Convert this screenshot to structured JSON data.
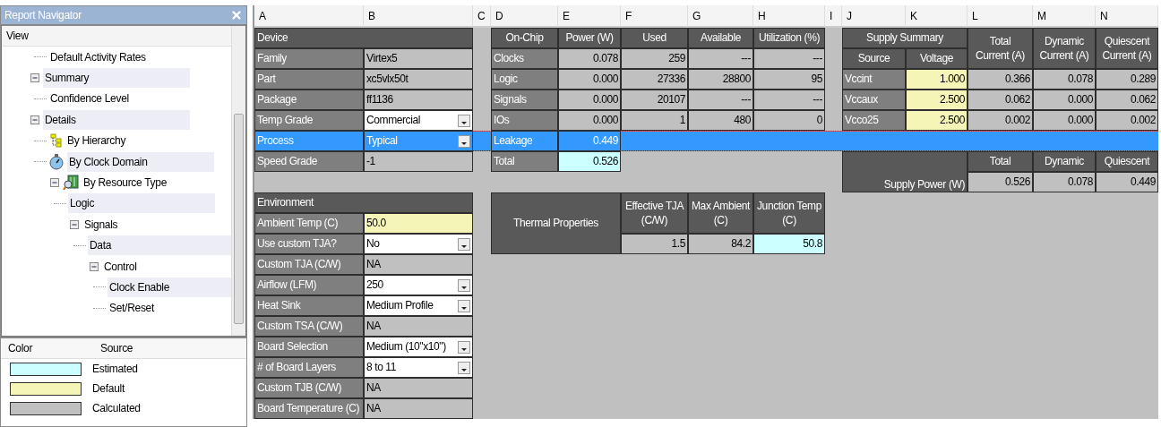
{
  "navigator": {
    "title": "Report Navigator",
    "view_header": "View",
    "tree": [
      {
        "children": [
          {
            "label": "Default Activity Rates",
            "shaded": false
          }
        ]
      },
      {
        "label": "Summary",
        "shaded": true,
        "expanded": true,
        "children": [
          {
            "label": "Confidence Level",
            "shaded": false
          }
        ]
      },
      {
        "label": "Details",
        "shaded": true,
        "expanded": true,
        "children": [
          {
            "label": "By Hierarchy",
            "kind": "hierarchy",
            "shaded": false
          },
          {
            "label": "By Clock Domain",
            "kind": "clock",
            "shaded": true
          },
          {
            "label": "By Resource Type",
            "kind": "resource",
            "shaded": false,
            "expanded": true,
            "children": [
              {
                "label": "Logic",
                "shaded": true
              },
              {
                "label": "Signals",
                "shaded": false,
                "expanded": true,
                "children": [
                  {
                    "label": "Data",
                    "shaded": true
                  },
                  {
                    "label": "Control",
                    "shaded": false,
                    "expanded": true,
                    "children": [
                      {
                        "label": "Clock Enable",
                        "shaded": true
                      },
                      {
                        "label": "Set/Reset",
                        "shaded": false
                      }
                    ]
                  }
                ]
              }
            ]
          }
        ]
      }
    ],
    "legend": {
      "columns": [
        "Color",
        "Source"
      ],
      "items": [
        {
          "color": "#ccffff",
          "label": "Estimated"
        },
        {
          "color": "#f5f5b8",
          "label": "Default"
        },
        {
          "color": "#c0c0c0",
          "label": "Calculated"
        }
      ]
    }
  },
  "sheet": {
    "columns": [
      "A",
      "B",
      "C",
      "D",
      "E",
      "F",
      "G",
      "H",
      "I",
      "J",
      "K",
      "L",
      "M",
      "N"
    ],
    "device": {
      "title": "Device",
      "rows": [
        {
          "label": "Family",
          "value": "Virtex5",
          "kind": "value",
          "selected": false
        },
        {
          "label": "Part",
          "value": "xc5vlx50t",
          "kind": "value",
          "selected": false
        },
        {
          "label": "Package",
          "value": "ff1136",
          "kind": "value",
          "selected": false
        },
        {
          "label": "Temp Grade",
          "value": "Commercial",
          "kind": "dropdown",
          "selected": false
        },
        {
          "label": "Process",
          "value": "Typical",
          "kind": "dropdown",
          "selected": true
        },
        {
          "label": "Speed Grade",
          "value": "-1",
          "kind": "value",
          "selected": false
        }
      ]
    },
    "environment": {
      "title": "Environment",
      "rows": [
        {
          "label": "Ambient Temp (C)",
          "value": "50.0",
          "kind": "input"
        },
        {
          "label": "Use custom TJA?",
          "value": "No",
          "kind": "dropdown"
        },
        {
          "label": "Custom TJA (C/W)",
          "value": "NA",
          "kind": "value"
        },
        {
          "label": "Airflow (LFM)",
          "value": "250",
          "kind": "dropdown"
        },
        {
          "label": "Heat Sink",
          "value": "Medium Profile",
          "kind": "dropdown"
        },
        {
          "label": "Custom TSA (C/W)",
          "value": "NA",
          "kind": "value"
        },
        {
          "label": "Board Selection",
          "value": "Medium (10\"x10\")",
          "kind": "dropdown"
        },
        {
          "label": "# of Board Layers",
          "value": "8 to 11",
          "kind": "dropdown"
        },
        {
          "label": "Custom TJB (C/W)",
          "value": "NA",
          "kind": "value"
        },
        {
          "label": "Board Temperature (C)",
          "value": "NA",
          "kind": "value"
        }
      ]
    },
    "on_chip": {
      "columns": [
        "On-Chip",
        "Power (W)",
        "Used",
        "Available",
        "Utilization (%)"
      ],
      "rows": [
        {
          "label": "Clocks",
          "values": [
            "0.078",
            "259",
            "---",
            "---"
          ]
        },
        {
          "label": "Logic",
          "values": [
            "0.000",
            "27336",
            "28800",
            "95"
          ]
        },
        {
          "label": "Signals",
          "values": [
            "0.000",
            "20107",
            "---",
            "---"
          ]
        },
        {
          "label": "IOs",
          "values": [
            "0.000",
            "1",
            "480",
            "0"
          ]
        }
      ],
      "leakage": {
        "label": "Leakage",
        "value": "0.449"
      },
      "total": {
        "label": "Total",
        "value": "0.526",
        "kind": "estimated"
      }
    },
    "thermal": {
      "title": "Thermal Properties",
      "columns": [
        [
          "Effective TJA",
          "(C/W)"
        ],
        [
          "Max Ambient",
          "(C)"
        ],
        [
          "Junction Temp",
          "(C)"
        ]
      ],
      "values": [
        {
          "value": "1.5",
          "kind": "value"
        },
        {
          "value": "84.2",
          "kind": "value"
        },
        {
          "value": "50.8",
          "kind": "estimated"
        }
      ]
    },
    "supply": {
      "title": "Supply Summary",
      "columns": [
        "Source",
        "Voltage"
      ],
      "current_columns": [
        [
          "Total",
          "Current (A)"
        ],
        [
          "Dynamic",
          "Current (A)"
        ],
        [
          "Quiescent",
          "Current (A)"
        ]
      ],
      "rows": [
        {
          "source": "Vccint",
          "voltage": "1.000",
          "values": [
            "0.366",
            "0.078",
            "0.289"
          ]
        },
        {
          "source": "Vccaux",
          "voltage": "2.500",
          "values": [
            "0.062",
            "0.000",
            "0.062"
          ]
        },
        {
          "source": "Vcco25",
          "voltage": "2.500",
          "values": [
            "0.002",
            "0.000",
            "0.002"
          ]
        }
      ]
    },
    "supply_power": {
      "title": "Supply Power (W)",
      "columns": [
        "Total",
        "Dynamic",
        "Quiescent"
      ],
      "values": [
        "0.526",
        "0.078",
        "0.449"
      ]
    }
  }
}
